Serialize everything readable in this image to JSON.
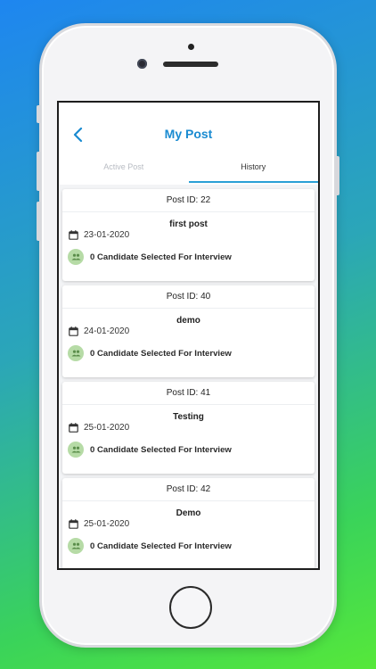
{
  "header": {
    "title": "My Post",
    "back_icon": "chevron-left-icon"
  },
  "tabs": [
    {
      "label": "Active Post",
      "active": false
    },
    {
      "label": "History",
      "active": true
    }
  ],
  "posts": [
    {
      "post_id": "Post ID: 22",
      "title": "first post",
      "date": "23-01-2020",
      "candidates": "0 Candidate Selected For Interview"
    },
    {
      "post_id": "Post ID: 40",
      "title": "demo",
      "date": "24-01-2020",
      "candidates": "0 Candidate Selected For Interview"
    },
    {
      "post_id": "Post ID: 41",
      "title": "Testing",
      "date": "25-01-2020",
      "candidates": "0 Candidate Selected For Interview"
    },
    {
      "post_id": "Post ID: 42",
      "title": "Demo",
      "date": "25-01-2020",
      "candidates": "0 Candidate Selected For Interview"
    }
  ],
  "colors": {
    "accent": "#1a8bd1",
    "tab_indicator": "#2aa0d6",
    "candidate_badge": "#b6dba6"
  }
}
